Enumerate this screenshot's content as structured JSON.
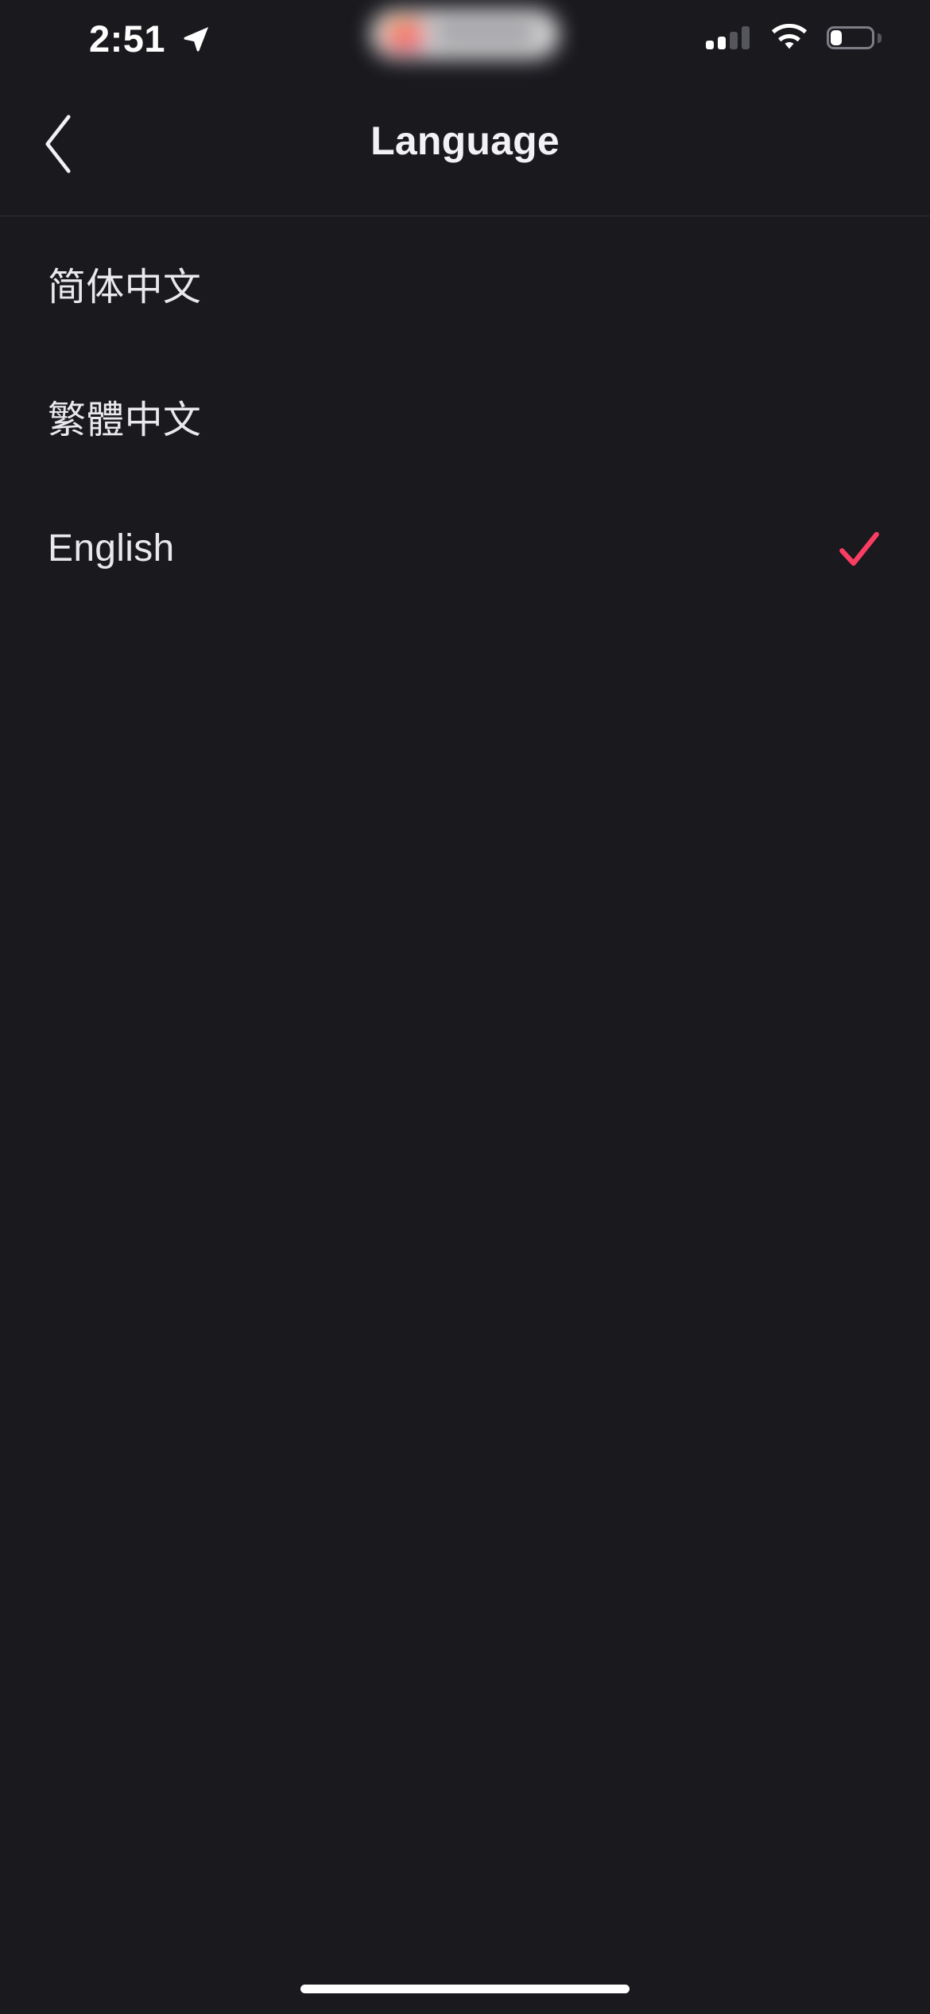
{
  "status_bar": {
    "time": "2:51",
    "location_icon": "location-arrow-icon",
    "dynamic_island": {
      "icon": "app-activity-icon",
      "label": "",
      "redacted": true
    },
    "cellular_icon": "cellular-signal-icon",
    "cellular_bars_active": 2,
    "cellular_bars_total": 4,
    "wifi_icon": "wifi-icon",
    "battery_icon": "battery-low-icon",
    "battery_level_percent": 25
  },
  "nav": {
    "back_icon": "chevron-left-icon",
    "title": "Language"
  },
  "languages": [
    {
      "label": "简体中文",
      "selected": false,
      "name": "simplified-chinese"
    },
    {
      "label": "繁體中文",
      "selected": false,
      "name": "traditional-chinese"
    },
    {
      "label": "English",
      "selected": true,
      "name": "english"
    }
  ],
  "check_icon_name": "checkmark-icon",
  "colors": {
    "background": "#19191e",
    "text_primary": "#e9e9ec",
    "text_title": "#f2f2f4",
    "accent_check": "#fa3d62",
    "separator": "#2d2d33",
    "home_indicator": "#ffffff"
  },
  "home_indicator": "home-indicator"
}
